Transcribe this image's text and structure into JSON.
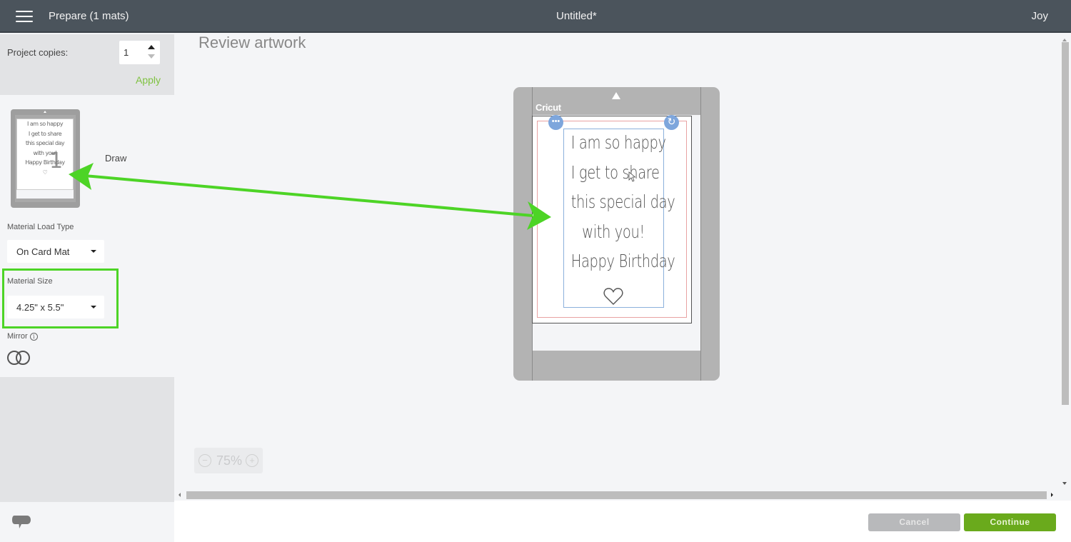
{
  "header": {
    "menu_icon": "hamburger-menu-icon",
    "title": "Prepare (1 mats)",
    "document_title": "Untitled*",
    "user": "Joy"
  },
  "sidebar": {
    "project_copies": {
      "label": "Project copies:",
      "value": "1",
      "apply_label": "Apply"
    },
    "mats": [
      {
        "number": "1",
        "label": "Draw",
        "thumbnail_lines": [
          "I am so happy",
          "I get to share",
          "this special day",
          "with you!",
          "Happy Birthday",
          "♡"
        ]
      }
    ],
    "material_load_type": {
      "label": "Material Load Type",
      "selected": "On Card Mat"
    },
    "material_size": {
      "label": "Material Size",
      "selected": "4.25\" x 5.5\""
    },
    "mirror": {
      "label": "Mirror",
      "info_icon": "ⓘ",
      "enabled": false
    }
  },
  "canvas": {
    "title": "Review artwork",
    "mat_brand": "Cricut",
    "design_lines": [
      "I am so happy",
      "I get to share",
      "this special day",
      "with you!",
      "Happy Birthday"
    ],
    "handles": {
      "more": "•••",
      "rotate": "↻"
    },
    "zoom": {
      "minus": "−",
      "value": "75%",
      "plus": "+"
    }
  },
  "annotation": {
    "highlight_color": "#4dd426",
    "arrow_color": "#4dd426"
  },
  "footer": {
    "chat_icon": "chat-bubble-icon",
    "cancel_label": "Cancel",
    "continue_label": "Continue"
  },
  "colors": {
    "header_bg": "#4b545c",
    "accent_green": "#6aaa1c",
    "apply_green": "#7fc241"
  }
}
